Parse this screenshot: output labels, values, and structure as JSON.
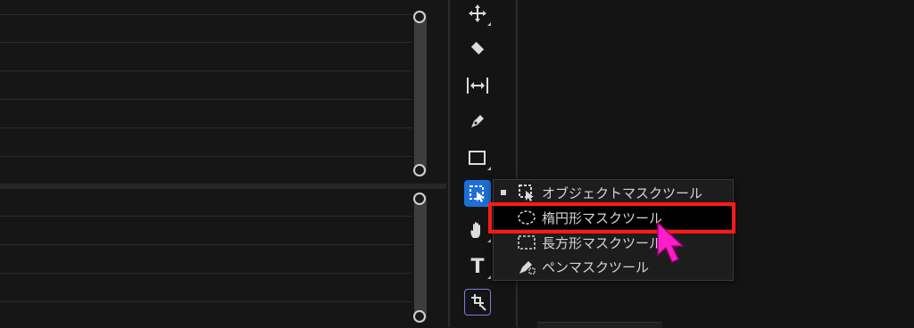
{
  "toolbar": {
    "tools": [
      {
        "name": "move-tool",
        "icon": "move-arrows-icon"
      },
      {
        "name": "eraser-tool",
        "icon": "eraser-icon"
      },
      {
        "name": "fit-tool",
        "icon": "horizontal-fit-icon"
      },
      {
        "name": "pen-tool",
        "icon": "pen-icon"
      },
      {
        "name": "rectangle-tool",
        "icon": "rectangle-icon"
      },
      {
        "name": "mask-tool",
        "icon": "object-mask-icon",
        "active": true
      },
      {
        "name": "hand-tool",
        "icon": "hand-icon"
      },
      {
        "name": "text-tool",
        "icon": "text-icon",
        "label": "T"
      },
      {
        "name": "transform-tool",
        "icon": "transform-icon"
      }
    ],
    "text_label": "T"
  },
  "flyout": {
    "items": [
      {
        "label": "オブジェクトマスクツール",
        "icon": "object-mask-icon",
        "selected": true
      },
      {
        "label": "楕円形マスクツール",
        "icon": "ellipse-mask-icon",
        "highlighted": true
      },
      {
        "label": "長方形マスクツール",
        "icon": "rectangle-mask-icon"
      },
      {
        "label": "ペンマスクツール",
        "icon": "pen-mask-icon"
      }
    ]
  },
  "colors": {
    "background": "#161616",
    "active_tool": "#1d6fd6",
    "highlight_box": "#ff1a1a",
    "cursor": "#ff1fc8"
  }
}
